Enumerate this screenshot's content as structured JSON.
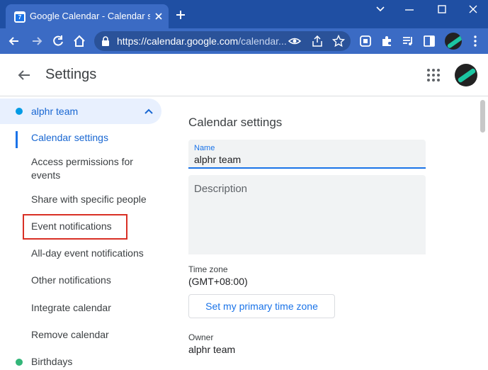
{
  "browser": {
    "tab_title": "Google Calendar - Calendar setti",
    "favicon_text": "7",
    "url_host": "https://calendar.google.com",
    "url_rest": "/calendar..."
  },
  "header": {
    "title": "Settings"
  },
  "sidebar": {
    "calendar_name": "alphr team",
    "items": [
      {
        "label": "Calendar settings"
      },
      {
        "label": "Access permissions for events"
      },
      {
        "label": "Share with specific people"
      },
      {
        "label": "Event notifications"
      },
      {
        "label": "All-day event notifications"
      },
      {
        "label": "Other notifications"
      },
      {
        "label": "Integrate calendar"
      },
      {
        "label": "Remove calendar"
      }
    ],
    "other_calendar": "Birthdays"
  },
  "main": {
    "section_title": "Calendar settings",
    "name_label": "Name",
    "name_value": "alphr team",
    "description_placeholder": "Description",
    "timezone_label": "Time zone",
    "timezone_value": "(GMT+08:00)",
    "timezone_button": "Set my primary time zone",
    "owner_label": "Owner",
    "owner_value": "alphr team"
  },
  "colors": {
    "chrome_title": "#1f4fa3",
    "chrome_toolbar": "#3b6bc4",
    "accent": "#1a73e8",
    "team_dot": "#039be5",
    "birthdays_dot": "#33b679",
    "highlight": "#d93025"
  },
  "icons": [
    "calendar-favicon",
    "close-icon",
    "plus-icon",
    "chevron-down-icon",
    "minimize-icon",
    "maximize-icon",
    "back-icon",
    "forward-icon",
    "reload-icon",
    "home-icon",
    "lock-icon",
    "eye-icon",
    "share-icon",
    "star-icon",
    "extension-icon",
    "puzzle-icon",
    "media-icon",
    "sidepanel-icon",
    "avatar",
    "arrow-left-icon",
    "apps-grid-icon",
    "chevron-up-icon"
  ]
}
